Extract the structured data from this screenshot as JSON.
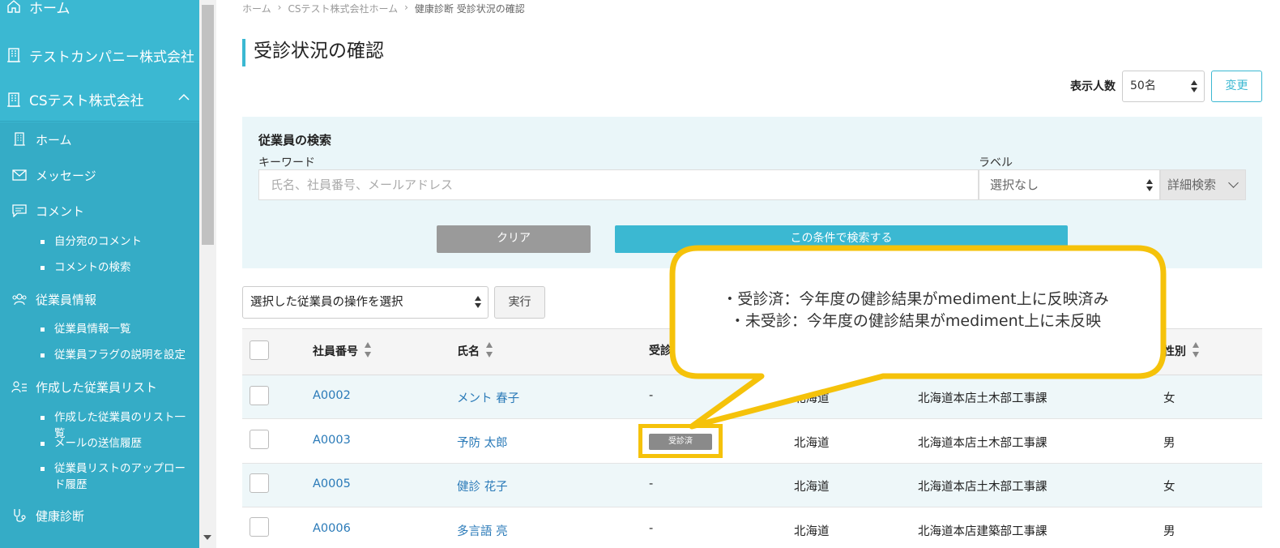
{
  "sidebar": {
    "home": "ホーム",
    "company1": "テストカンパニー株式会社",
    "company2": "CSテスト株式会社",
    "items": {
      "home": "ホーム",
      "messages": "メッセージ",
      "comments": "コメント",
      "comments_sub1": "自分宛のコメント",
      "comments_sub2": "コメントの検索",
      "employee_info": "従業員情報",
      "employee_info_sub1": "従業員情報一覧",
      "employee_info_sub2": "従業員フラグの説明を設定",
      "created_lists": "作成した従業員リスト",
      "created_lists_sub1": "作成した従業員のリスト一覧",
      "created_lists_sub2": "メールの送信履歴",
      "created_lists_sub3": "従業員リストのアップロード履歴",
      "health_check": "健康診断"
    }
  },
  "breadcrumb": {
    "home": "ホーム",
    "sep": "›",
    "company_home": "CSテスト株式会社ホーム",
    "current": "健康診断 受診状況の確認"
  },
  "page": {
    "title": "受診状況の確認",
    "display_count_label": "表示人数",
    "display_count_value": "50名",
    "change_button": "変更"
  },
  "search": {
    "title": "従業員の検索",
    "keyword_label": "キーワード",
    "keyword_placeholder": "氏名、社員番号、メールアドレス",
    "label_label": "ラベル",
    "label_value": "選択なし",
    "detail_search": "詳細検索",
    "clear_button": "クリア",
    "search_button": "この条件で検索する"
  },
  "bulk": {
    "operation_select": "選択した従業員の操作を選択",
    "execute_button": "実行"
  },
  "table": {
    "headers": {
      "employee_no": "社員番号",
      "name": "氏名",
      "status": "受診",
      "gender": "性別"
    },
    "rows": [
      {
        "no": "A0002",
        "name": "メント 春子",
        "status": "-",
        "region": "北海道",
        "dept": "北海道本店土木部工事課",
        "gender": "女"
      },
      {
        "no": "A0003",
        "name": "予防 太郎",
        "status": "受診済",
        "region": "北海道",
        "dept": "北海道本店土木部工事課",
        "gender": "男"
      },
      {
        "no": "A0005",
        "name": "健診 花子",
        "status": "-",
        "region": "北海道",
        "dept": "北海道本店土木部工事課",
        "gender": "女"
      },
      {
        "no": "A0006",
        "name": "多言語 亮",
        "status": "-",
        "region": "北海道",
        "dept": "北海道本店建築部工事課",
        "gender": "男"
      }
    ]
  },
  "callout": {
    "line1": "・受診済：今年度の健診結果がmediment上に反映済み",
    "line2": "・未受診：今年度の健診結果がmediment上に未反映"
  },
  "colors": {
    "accent": "#3bb8d2",
    "highlight": "#f5c20a",
    "link": "#2a7ab8"
  }
}
